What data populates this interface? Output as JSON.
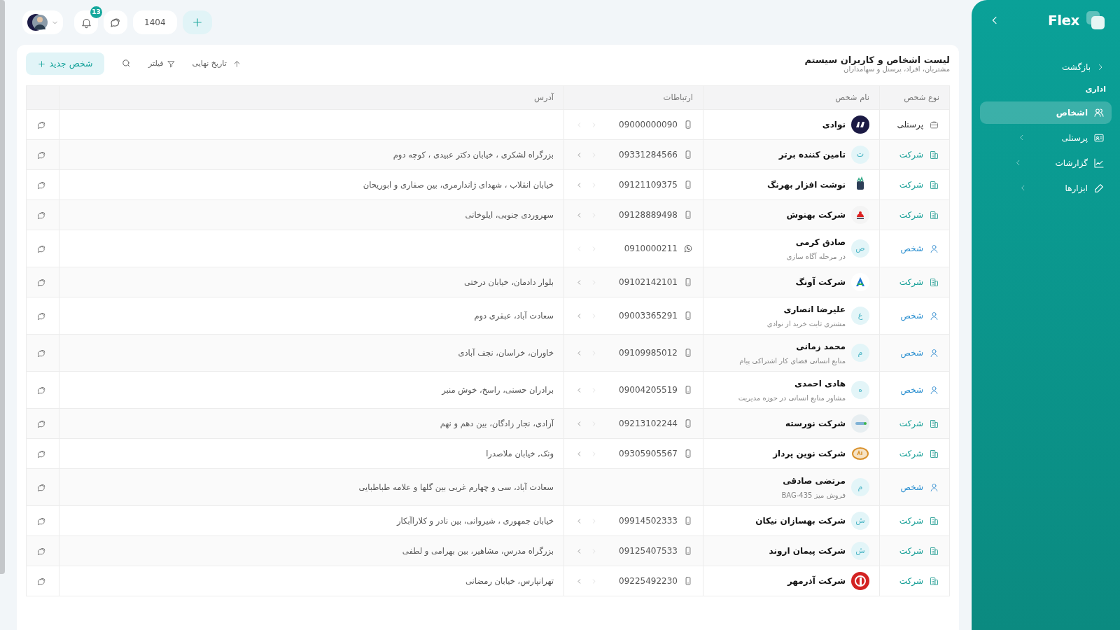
{
  "topbar": {
    "notifications": "13",
    "year": "1404"
  },
  "header": {
    "title": "لیست اشخاص و کاربران سیستم",
    "subtitle": "مشتریان، افراد، پرسنل و سهامداران"
  },
  "toolbar": {
    "sort": "تاریخ نهایی",
    "filter": "فیلتر",
    "new_button": "شخص جدید"
  },
  "table": {
    "columns": [
      "نوع شخص",
      "نام شخص",
      "ارتباطات",
      "آدرس"
    ],
    "rows": [
      {
        "type": "پرسنلی",
        "kind": "personnel",
        "name": "نوادی",
        "avatar": {
          "kind": "logo"
        },
        "contact": {
          "kind": "mobile",
          "phone": "09000000090",
          "next_enabled": false
        }
      },
      {
        "type": "شرکت",
        "kind": "company",
        "name": "تامین کننده برتر",
        "avatar": {
          "kind": "letter",
          "letter": "ت"
        },
        "contact": {
          "kind": "mobile",
          "phone": "09331284566",
          "next_enabled": true
        },
        "address": "بزرگراه لشکری ، خیابان دکتر عبیدی ، کوچه دوم"
      },
      {
        "type": "شرکت",
        "kind": "company",
        "name": "نوشت افزار بهرنگ",
        "avatar": {
          "kind": "logo"
        },
        "contact": {
          "kind": "mobile",
          "phone": "09121109375",
          "next_enabled": true
        },
        "address": "خیابان انقلاب ، شهدای ژاندارمری، بین صفاری و ابوریحان"
      },
      {
        "type": "شرکت",
        "kind": "company",
        "name": "شرکت بهنوش",
        "avatar": {
          "kind": "logo"
        },
        "contact": {
          "kind": "mobile",
          "phone": "09128889498",
          "next_enabled": true
        },
        "address": "سهروردی جنوبی، ایلوخانی"
      },
      {
        "type": "شخص",
        "kind": "person",
        "name": "صادق کرمی",
        "note": "در مرحله آگاه سازی",
        "avatar": {
          "kind": "letter",
          "letter": "ص"
        },
        "contact": {
          "kind": "whatsapp",
          "phone": "0910000211",
          "next_enabled": false
        }
      },
      {
        "type": "شرکت",
        "kind": "company",
        "name": "شرکت آونگ",
        "avatar": {
          "kind": "logo"
        },
        "contact": {
          "kind": "mobile",
          "phone": "09102142101",
          "next_enabled": true
        },
        "address": "بلوار دادمان، خیابان درختی"
      },
      {
        "type": "شخص",
        "kind": "person",
        "name": "علیرضا انصاری",
        "note": "مشتری ثابت خرید از نوادی",
        "avatar": {
          "kind": "letter",
          "letter": "ع"
        },
        "contact": {
          "kind": "mobile",
          "phone": "09003365291",
          "next_enabled": true
        },
        "address": "سعادت آباد، عبقری دوم"
      },
      {
        "type": "شخص",
        "kind": "person",
        "name": "محمد زمانی",
        "note": "منابع انسانی فضای کار اشتراکی پیام",
        "avatar": {
          "kind": "letter",
          "letter": "م"
        },
        "contact": {
          "kind": "mobile",
          "phone": "09109985012",
          "next_enabled": true
        },
        "address": "خاوران، خراسان، نجف آبادی"
      },
      {
        "type": "شخص",
        "kind": "person",
        "name": "هادی احمدی",
        "note": "مشاور منابع انسانی در حوزه مدیریت",
        "avatar": {
          "kind": "letter",
          "letter": "ه"
        },
        "contact": {
          "kind": "mobile",
          "phone": "09004205519",
          "next_enabled": true
        },
        "address": "برادران حسنی، راسخ، خوش منبر"
      },
      {
        "type": "شرکت",
        "kind": "company",
        "name": "شرکت نورسته",
        "avatar": {
          "kind": "logo"
        },
        "contact": {
          "kind": "mobile",
          "phone": "09213102244",
          "next_enabled": true
        },
        "address": "آزادی، نجار زادگان، بین دهم و نهم"
      },
      {
        "type": "شرکت",
        "kind": "company",
        "name": "شرکت نوین پرداز",
        "avatar": {
          "kind": "logo"
        },
        "contact": {
          "kind": "mobile",
          "phone": "09305905567",
          "next_enabled": true
        },
        "address": "ونک, خیابان ملاصدرا"
      },
      {
        "type": "شخص",
        "kind": "person",
        "name": "مرتضی صادقی",
        "note": "فروش میز BAG-435",
        "avatar": {
          "kind": "letter",
          "letter": "م"
        },
        "address": "سعادت آباد، سی و چهارم غربی بین گلها و علامه طباطبایی"
      },
      {
        "type": "شرکت",
        "kind": "company",
        "name": "شرکت بهسازان نیکان",
        "avatar": {
          "kind": "letter",
          "letter": "ش"
        },
        "contact": {
          "kind": "mobile",
          "phone": "09914502333",
          "next_enabled": true
        },
        "address": "خیابان جمهوری ، شیروانی، بین نادر و کلاراآبکار"
      },
      {
        "type": "شرکت",
        "kind": "company",
        "name": "شرکت پیمان اروند",
        "avatar": {
          "kind": "letter",
          "letter": "ش"
        },
        "contact": {
          "kind": "mobile",
          "phone": "09125407533",
          "next_enabled": true
        },
        "address": "بزرگراه مدرس، مشاهیر، بین بهرامی و لطفی"
      },
      {
        "type": "شرکت",
        "kind": "company",
        "name": "شرکت آذرمهر",
        "avatar": {
          "kind": "logo"
        },
        "contact": {
          "kind": "mobile",
          "phone": "09225492230",
          "next_enabled": true
        },
        "address": "تهرانپارس، خیابان رمضانی"
      }
    ]
  },
  "sidebar": {
    "logo": "Flex",
    "back": "بازگشت",
    "section": "اداری",
    "items": [
      {
        "label": "اشخاص",
        "kind": "people",
        "selected": true,
        "expandable": false
      },
      {
        "label": "پرسنلی",
        "kind": "card",
        "selected": false,
        "expandable": true
      },
      {
        "label": "گزارشات",
        "kind": "chart",
        "selected": false,
        "expandable": true
      },
      {
        "label": "ابزارها",
        "kind": "pencil",
        "selected": false,
        "expandable": true
      }
    ]
  }
}
